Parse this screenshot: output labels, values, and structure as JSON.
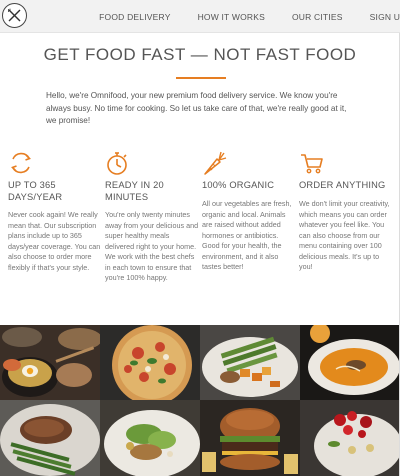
{
  "brand": {
    "logo_icon": "fork-knife-icon",
    "accent": "#e67e22"
  },
  "nav": {
    "items": [
      "FOOD DELIVERY",
      "HOW IT WORKS",
      "OUR CITIES",
      "SIGN UP"
    ]
  },
  "hero": {
    "headline": "GET FOOD FAST — NOT FAST FOOD",
    "intro": "Hello, we're Omnifood, your new premium food delivery service. We know you're always busy. No time for cooking. So let us take care of that, we're really good at it, we promise!"
  },
  "features": [
    {
      "icon": "infinity-arrows-icon",
      "title": "UP TO 365 DAYS/YEAR",
      "text": "Never cook again! We really mean that. Our subscription plans include up to 365 days/year coverage. You can also choose to order more flexibly if that's your style."
    },
    {
      "icon": "stopwatch-icon",
      "title": "READY IN 20 MINUTES",
      "text": "You're only twenty minutes away from your delicious and super healthy meals delivered right to your home. We work with the best chefs in each town to ensure that you're 100% happy."
    },
    {
      "icon": "carrot-icon",
      "title": "100% ORGANIC",
      "text": "All our vegetables are fresh, organic and local. Animals are raised without added hormones or antibiotics. Good for your health, the environment, and it also tastes better!"
    },
    {
      "icon": "cart-icon",
      "title": "ORDER ANYTHING",
      "text": "We don't limit your creativity, which means you can order whatever you feel like. You can also choose from our menu containing over 100 delicious meals. It's up to you!"
    }
  ],
  "gallery": [
    "egg-rice-bowl-photo",
    "pizza-photo",
    "grilled-vegetables-photo",
    "soup-photo",
    "steak-asparagus-photo",
    "salad-plate-photo",
    "burger-photo",
    "fruit-plate-photo"
  ]
}
